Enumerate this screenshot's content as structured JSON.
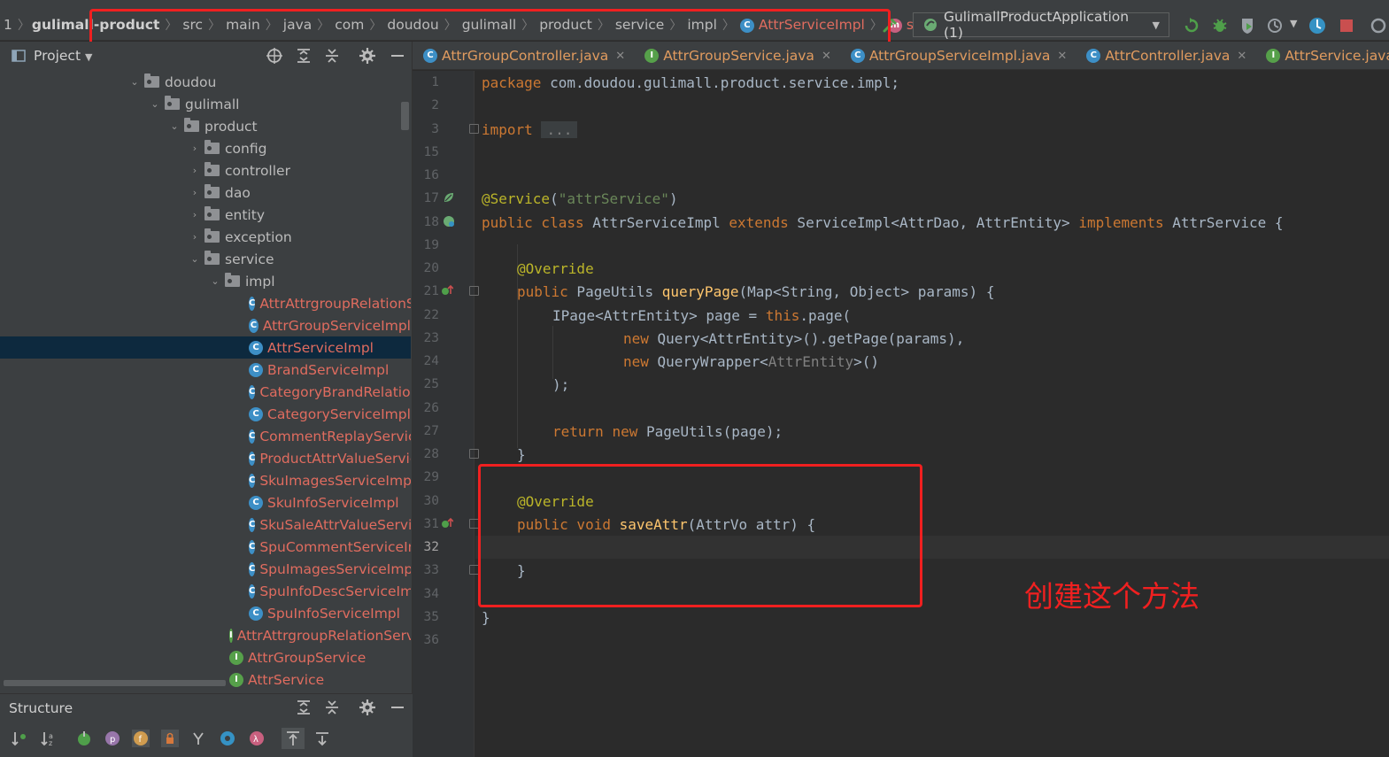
{
  "breadcrumb": {
    "items": [
      "1",
      "gulimall-product",
      "src",
      "main",
      "java",
      "com",
      "doudou",
      "gulimall",
      "product",
      "service",
      "impl"
    ],
    "class_name": "AttrServiceImpl",
    "method_name": "saveAttr",
    "class_icon": "C",
    "method_icon": "m"
  },
  "toolbar": {
    "run_config": "GulimallProductApplication (1)"
  },
  "tabs": [
    {
      "label": "AttrGroupController.java",
      "icon": "C"
    },
    {
      "label": "AttrGroupService.java",
      "icon": "I"
    },
    {
      "label": "AttrGroupServiceImpl.java",
      "icon": "C"
    },
    {
      "label": "AttrController.java",
      "icon": "C"
    },
    {
      "label": "AttrService.java",
      "icon": "I"
    }
  ],
  "project_panel": {
    "title": "Project",
    "tree": [
      {
        "label": "doudou",
        "type": "folder",
        "arrow": "v"
      },
      {
        "label": "gulimall",
        "type": "folder",
        "arrow": "v"
      },
      {
        "label": "product",
        "type": "folder",
        "arrow": "v"
      },
      {
        "label": "config",
        "type": "folder",
        "arrow": ">"
      },
      {
        "label": "controller",
        "type": "folder",
        "arrow": ">"
      },
      {
        "label": "dao",
        "type": "folder",
        "arrow": ">"
      },
      {
        "label": "entity",
        "type": "folder",
        "arrow": ">"
      },
      {
        "label": "exception",
        "type": "folder",
        "arrow": ">"
      },
      {
        "label": "service",
        "type": "folder",
        "arrow": "v"
      },
      {
        "label": "impl",
        "type": "folder",
        "arrow": "v"
      },
      {
        "label": "AttrAttrgroupRelationServiceImpl",
        "type": "class"
      },
      {
        "label": "AttrGroupServiceImpl",
        "type": "class"
      },
      {
        "label": "AttrServiceImpl",
        "type": "class",
        "selected": true
      },
      {
        "label": "BrandServiceImpl",
        "type": "class"
      },
      {
        "label": "CategoryBrandRelationServiceImpl",
        "type": "class"
      },
      {
        "label": "CategoryServiceImpl",
        "type": "class"
      },
      {
        "label": "CommentReplayServiceImpl",
        "type": "class"
      },
      {
        "label": "ProductAttrValueServiceImpl",
        "type": "class"
      },
      {
        "label": "SkuImagesServiceImpl",
        "type": "class"
      },
      {
        "label": "SkuInfoServiceImpl",
        "type": "class"
      },
      {
        "label": "SkuSaleAttrValueServiceImpl",
        "type": "class"
      },
      {
        "label": "SpuCommentServiceImpl",
        "type": "class"
      },
      {
        "label": "SpuImagesServiceImpl",
        "type": "class"
      },
      {
        "label": "SpuInfoDescServiceImpl",
        "type": "class"
      },
      {
        "label": "SpuInfoServiceImpl",
        "type": "class"
      },
      {
        "label": "AttrAttrgroupRelationService",
        "type": "interface"
      },
      {
        "label": "AttrGroupService",
        "type": "interface"
      },
      {
        "label": "AttrService",
        "type": "interface"
      }
    ]
  },
  "structure_panel": {
    "title": "Structure"
  },
  "editor": {
    "line_numbers": [
      "1",
      "2",
      "3",
      "15",
      "16",
      "17",
      "18",
      "19",
      "20",
      "21",
      "22",
      "23",
      "24",
      "25",
      "26",
      "27",
      "28",
      "29",
      "30",
      "31",
      "32",
      "33",
      "34",
      "35",
      "36"
    ],
    "current_line": "32",
    "code": {
      "l1_kw": "package",
      "l1_rest": " com.doudou.gulimall.product.service.impl;",
      "l3_kw": "import",
      "l3_fold": "...",
      "l17_ann": "@Service",
      "l17_paren_open": "(",
      "l17_str": "\"attrService\"",
      "l17_paren_close": ")",
      "l18_kw1": "public class",
      "l18_name": " AttrServiceImpl ",
      "l18_kw2": "extends",
      "l18_mid": " ServiceImpl<AttrDao, AttrEntity> ",
      "l18_kw3": "implements",
      "l18_end": " AttrService {",
      "l20_ann": "@Override",
      "l21_kw": "public",
      "l21_type": " PageUtils ",
      "l21_fn": "queryPage",
      "l21_rest": "(Map<String, Object> params) {",
      "l22_a": "IPage<AttrEntity> page = ",
      "l22_kw": "this",
      "l22_b": ".page(",
      "l23_kw": "new",
      "l23_rest": " Query<AttrEntity>().getPage(params),",
      "l24_kw": "new",
      "l24_a": " QueryWrapper<",
      "l24_gray": "AttrEntity",
      "l24_b": ">()",
      "l25": ");",
      "l27_kw1": "return",
      "l27_kw2": "new",
      "l27_rest": " PageUtils(page);",
      "l28": "}",
      "l30_ann": "@Override",
      "l31_kw": "public void",
      "l31_fn": "saveAttr",
      "l31_rest": "(AttrVo attr) {",
      "l33": "}",
      "l35": "}"
    }
  },
  "annotation_note": "创建这个方法",
  "colors": {
    "highlight_box": "#f02020",
    "keyword": "#cc7832",
    "annotation": "#bbb529",
    "string": "#6a8759",
    "function": "#ffc66d",
    "class_file": "#e06c5f"
  }
}
